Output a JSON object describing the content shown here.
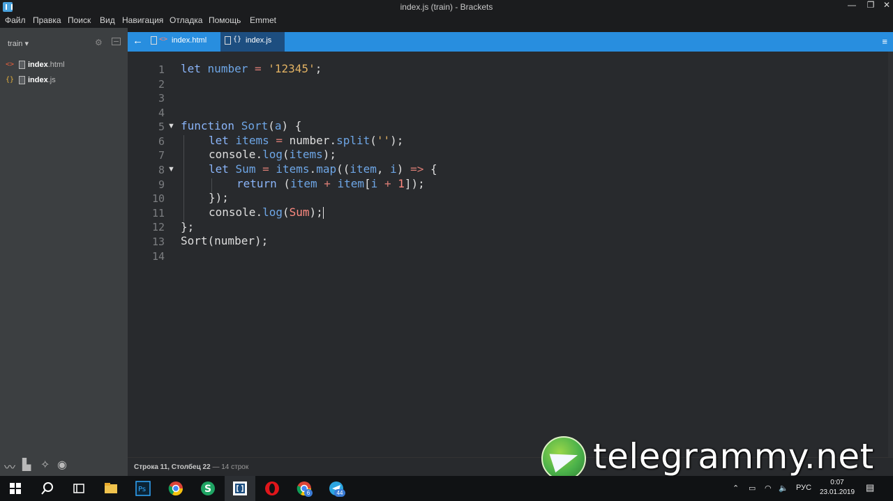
{
  "window": {
    "title": "index.js (train) - Brackets",
    "controls": [
      "—",
      "❐",
      "✕"
    ]
  },
  "menu": [
    "Файл",
    "Правка",
    "Поиск",
    "Вид",
    "Навигация",
    "Отладка",
    "Помощь",
    "Emmet"
  ],
  "sidebar": {
    "project": "train ▾",
    "files": [
      {
        "icon": "<>",
        "name_bold": "index",
        "ext": ".html"
      },
      {
        "icon": "{}",
        "name_bold": "index",
        "ext": ".js"
      }
    ]
  },
  "tabs": [
    {
      "glyph": "<>",
      "label": "index.html"
    },
    {
      "glyph": "{}",
      "label": "index.js"
    }
  ],
  "editor": {
    "line_numbers": [
      "1",
      "2",
      "3",
      "4",
      "5",
      "6",
      "7",
      "8",
      "9",
      "10",
      "11",
      "12",
      "13",
      "14"
    ],
    "fold_marks": [
      "▼",
      "▼"
    ],
    "lines": {
      "l1": [
        "let",
        "number",
        "=",
        "'12345'",
        ";"
      ],
      "l5": [
        "function",
        "Sort",
        "(",
        "a",
        ") {"
      ],
      "l6": [
        "let",
        "items",
        "=",
        "number",
        ".",
        "split",
        "(",
        "''",
        ");"
      ],
      "l7": [
        "console",
        ".",
        "log",
        "(",
        "items",
        ");"
      ],
      "l8": [
        "let",
        "Sum",
        "=",
        "items",
        ".",
        "map",
        "((",
        "item",
        ", ",
        "i",
        ") ",
        "=>",
        " {"
      ],
      "l9": [
        "return",
        " (",
        "item",
        " + ",
        "item",
        "[",
        "i",
        " + ",
        "1",
        "]);"
      ],
      "l10": [
        "});"
      ],
      "l11": [
        "console",
        ".",
        "log",
        "(",
        "Sum",
        ");"
      ],
      "l12": [
        "};"
      ],
      "l13": [
        "Sort",
        "(number);"
      ]
    }
  },
  "status": {
    "position": "Строка 11, Столбец 22",
    "lines": "— 14 строк"
  },
  "watermark": "telegrammy.net",
  "taskbar": {
    "lang": "РУС",
    "time": "0:07",
    "date": "23.01.2019",
    "badges": {
      "chrome2": "6",
      "telegram": "44"
    }
  },
  "colors": {
    "accent": "#288edf",
    "active_tab": "#1d4e80",
    "editor_bg": "#282a2d",
    "sidebar_bg": "#3c3f41"
  }
}
